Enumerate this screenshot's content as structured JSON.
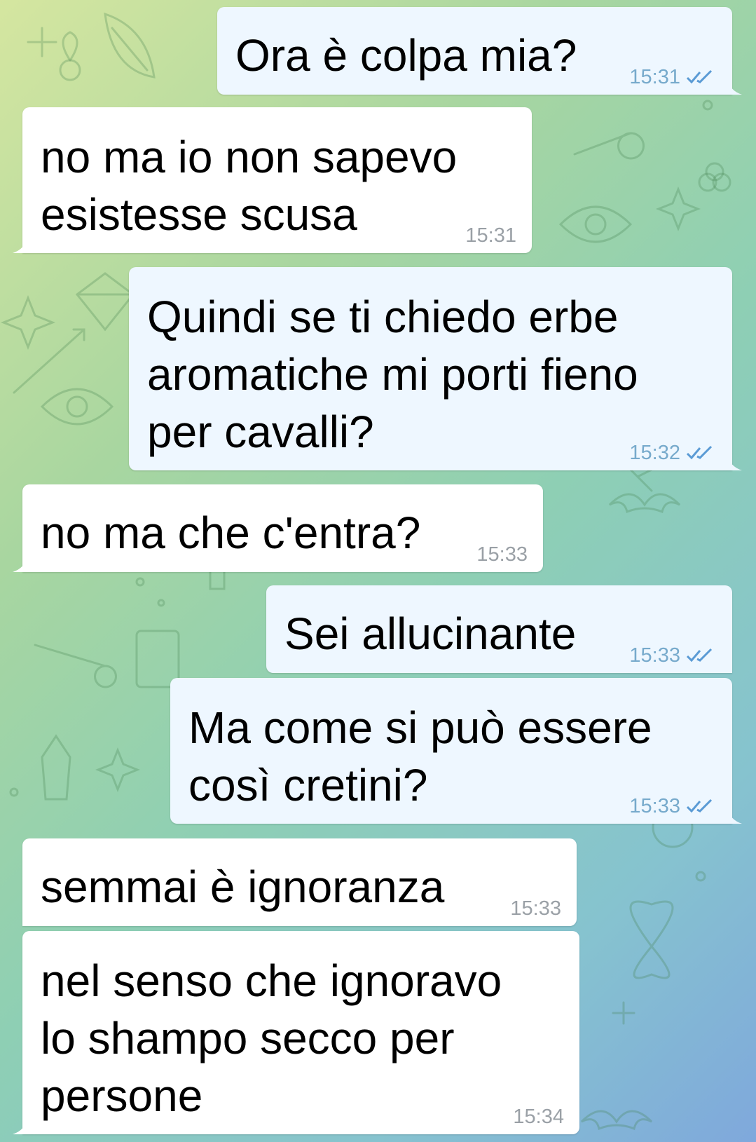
{
  "colors": {
    "incoming_bubble": "#ffffff",
    "outgoing_bubble": "#eef7ff",
    "read_check": "#5b9bd5"
  },
  "messages": [
    {
      "direction": "out",
      "text": "Ora è colpa mia?",
      "time": "15:31",
      "status": "read"
    },
    {
      "direction": "in",
      "text": "no ma io non sapevo\nesistesse scusa",
      "time": "15:31"
    },
    {
      "direction": "out",
      "text": "Quindi se ti chiedo erbe\naromatiche mi porti fieno\nper cavalli?",
      "time": "15:32",
      "status": "read"
    },
    {
      "direction": "in",
      "text": "no ma che c'entra?",
      "time": "15:33"
    },
    {
      "direction": "out",
      "text": "Sei allucinante",
      "time": "15:33",
      "status": "read"
    },
    {
      "direction": "out",
      "text": "Ma come si può essere\ncosì cretini?",
      "time": "15:33",
      "status": "read"
    },
    {
      "direction": "in",
      "text": "semmai è ignoranza",
      "time": "15:33"
    },
    {
      "direction": "in",
      "text": "nel senso che ignoravo\nlo shampo secco per\npersone",
      "time": "15:34"
    }
  ]
}
